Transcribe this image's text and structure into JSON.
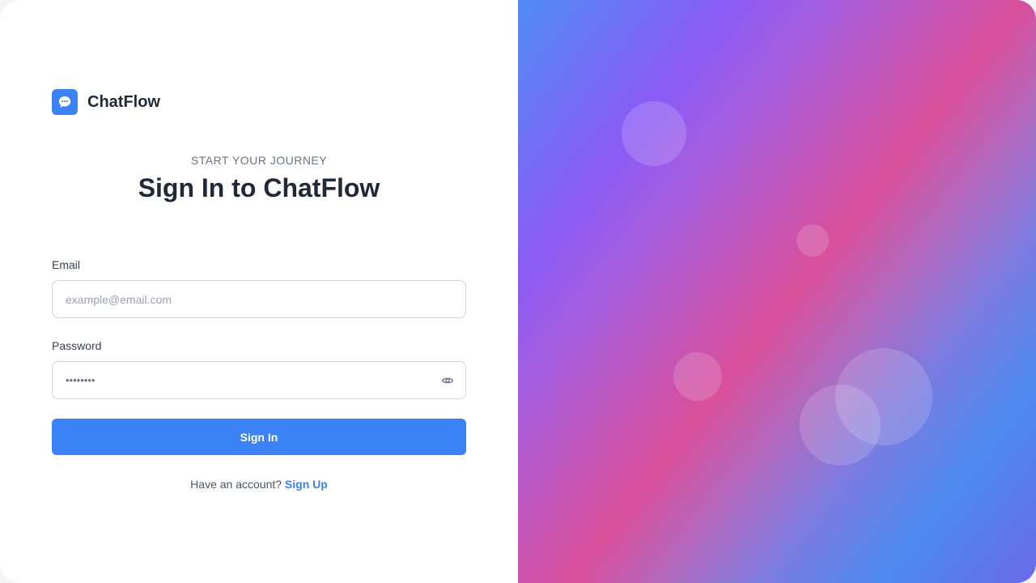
{
  "brand": {
    "name": "ChatFlow",
    "logo_icon": "chat-bubble-icon"
  },
  "header": {
    "eyebrow": "START YOUR JOURNEY",
    "title": "Sign In to ChatFlow"
  },
  "form": {
    "email_label": "Email",
    "email_placeholder": "example@email.com",
    "password_label": "Password",
    "password_value": "••••••••",
    "password_toggle_icon": "eye-icon",
    "submit_label": "Sign In"
  },
  "footer": {
    "prompt": "Have an account?",
    "link_label": "Sign Up"
  },
  "colors": {
    "accent": "#3b82f6",
    "text_dark": "#1f2937",
    "text_muted": "#6b7280"
  }
}
